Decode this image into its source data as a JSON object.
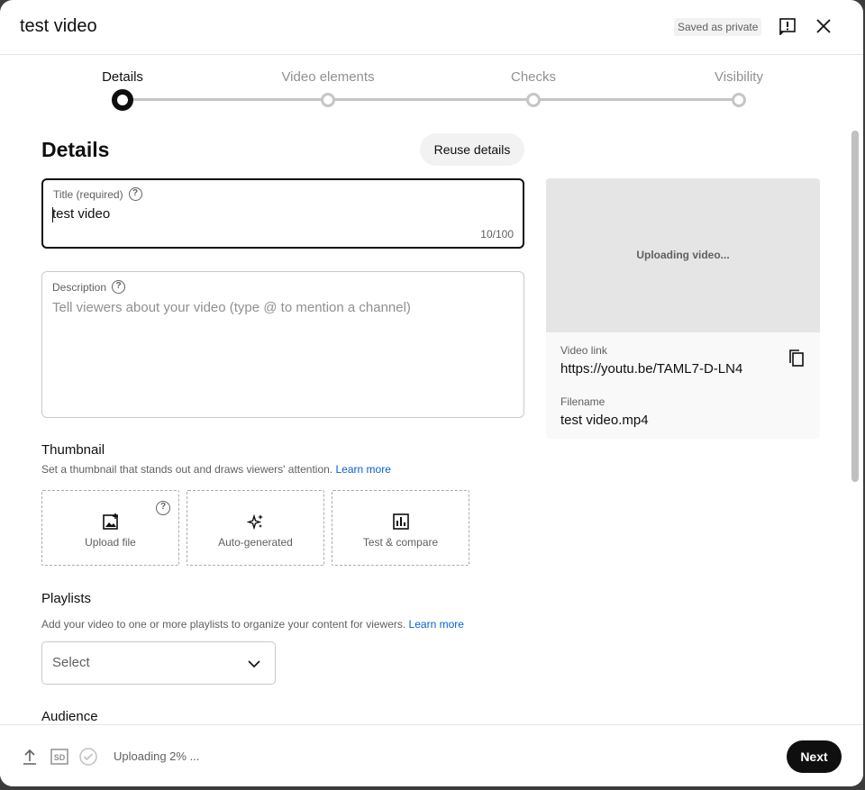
{
  "header": {
    "title": "test video",
    "saved_badge": "Saved as private",
    "icons": {
      "feedback": "feedback-icon",
      "close": "close-icon"
    }
  },
  "stepper": {
    "steps": [
      {
        "label": "Details",
        "active": true
      },
      {
        "label": "Video elements",
        "active": false
      },
      {
        "label": "Checks",
        "active": false
      },
      {
        "label": "Visibility",
        "active": false
      }
    ]
  },
  "details": {
    "heading": "Details",
    "reuse_label": "Reuse details",
    "title_field": {
      "label": "Title (required)",
      "value": "test video",
      "counter": "10/100"
    },
    "description_field": {
      "label": "Description",
      "placeholder": "Tell viewers about your video (type @ to mention a channel)"
    },
    "help_glyph": "?"
  },
  "thumbnail": {
    "heading": "Thumbnail",
    "text": "Set a thumbnail that stands out and draws viewers' attention.",
    "learn_more": "Learn more",
    "options": [
      {
        "label": "Upload file",
        "icon": "add-image-icon"
      },
      {
        "label": "Auto-generated",
        "icon": "sparkle-icon"
      },
      {
        "label": "Test & compare",
        "icon": "bar-chart-icon"
      }
    ]
  },
  "playlists": {
    "heading": "Playlists",
    "text": "Add your video to one or more playlists to organize your content for viewers.",
    "learn_more": "Learn more",
    "select_value": "Select"
  },
  "audience": {
    "heading": "Audience"
  },
  "preview": {
    "status": "Uploading video...",
    "link_label": "Video link",
    "link_value": "https://youtu.be/TAML7-D-LN4",
    "filename_label": "Filename",
    "filename_value": "test video.mp4"
  },
  "footer": {
    "status": "Uploading 2% ...",
    "upload_progress_percent": 2,
    "sd_badge": "SD",
    "next_label": "Next"
  },
  "colors": {
    "link": "#065fd4",
    "primary_button": "#0f0f0f"
  }
}
